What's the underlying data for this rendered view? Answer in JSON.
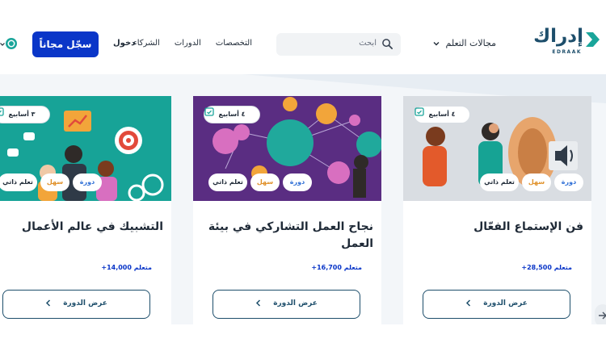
{
  "header": {
    "logo_ar": "إدراك",
    "logo_en": "EDRAAK",
    "nav_fields": "مجالات التعلم",
    "search_placeholder": "ابحث",
    "links": [
      "التخصصات",
      "الدورات",
      "الشركاء"
    ],
    "login": "دخول",
    "signup": "سجّل مجاناً"
  },
  "colors": {
    "primary": "#0a36c8",
    "brand": "#1d4e6b",
    "accent_green": "#1aa59a",
    "count_blue": "#0a36c8"
  },
  "cards": [
    {
      "duration": "٤ أسابيع",
      "chips": [
        "دورة",
        "سهل",
        "تعلم ذاتي"
      ],
      "title": "فن الإستماع الفعّال",
      "learners": "+28,500 متعلم",
      "button": "عرض الدورة"
    },
    {
      "duration": "٤ أسابيع",
      "chips": [
        "دورة",
        "سهل",
        "تعلم ذاتي"
      ],
      "title": "نجاح العمل التشاركي في بيئة العمل",
      "learners": "+16,700 متعلم",
      "button": "عرض الدورة"
    },
    {
      "duration": "٣ أسابيع",
      "chips": [
        "دورة",
        "سهل",
        "تعلم ذاتي"
      ],
      "title": "التشبيك في عالم الأعمال",
      "learners": "+14,000 متعلم",
      "button": "عرض الدورة"
    }
  ]
}
